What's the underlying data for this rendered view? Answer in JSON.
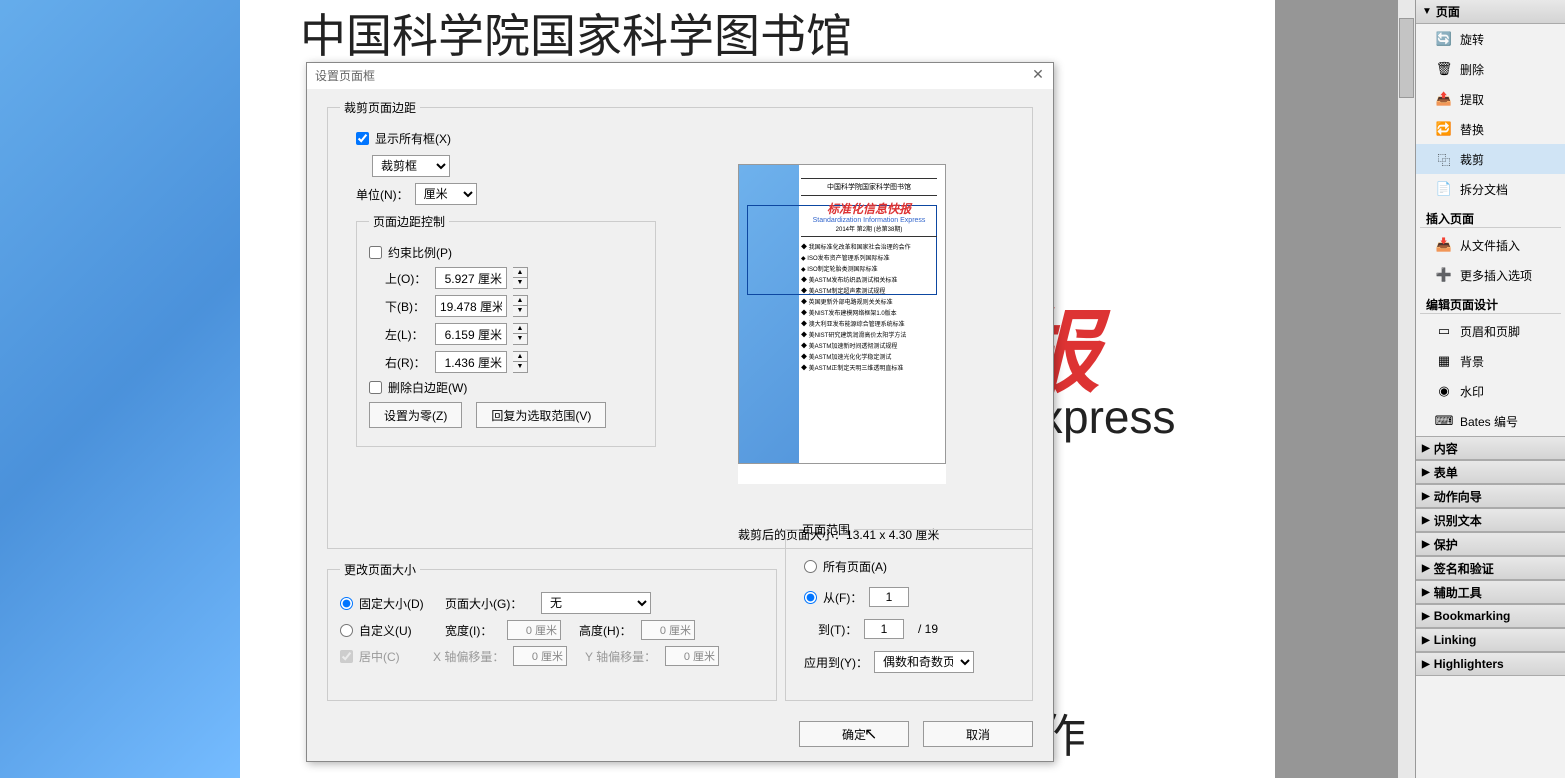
{
  "doc": {
    "title": "中国科学院国家科学图书馆",
    "red": "报",
    "eng": "xpress",
    "foot": "作"
  },
  "dialog": {
    "title": "设置页面框",
    "crop_margin_legend": "裁剪页面边距",
    "show_all_boxes": "显示所有框(X)",
    "box_type": "裁剪框",
    "unit_label": "单位(N)：",
    "unit_value": "厘米",
    "margin_control_legend": "页面边距控制",
    "constrain": "约束比例(P)",
    "top_label": "上(O)：",
    "bottom_label": "下(B)：",
    "left_label": "左(L)：",
    "right_label": "右(R)：",
    "top_val": "5.927 厘米",
    "bottom_val": "19.478 厘米",
    "left_val": "6.159 厘米",
    "right_val": "1.436 厘米",
    "remove_white": "删除白边距(W)",
    "set_zero": "设置为零(Z)",
    "restore_sel": "回复为选取范围(V)",
    "cropped_size_label": "裁剪后的页面大小：",
    "cropped_size_value": "13.41 x 4.30 厘米",
    "change_size_legend": "更改页面大小",
    "fixed_size": "固定大小(D)",
    "page_size_label": "页面大小(G)：",
    "page_size_value": "无",
    "custom": "自定义(U)",
    "width_label": "宽度(I)：",
    "height_label": "高度(H)：",
    "zero_cm": "0 厘米",
    "center": "居中(C)",
    "x_offset": "X 轴偏移量：",
    "y_offset": "Y 轴偏移量：",
    "range_legend": "页面范围",
    "all_pages": "所有页面(A)",
    "from_label": "从(F)：",
    "from_val": "1",
    "to_label": "到(T)：",
    "to_val": "1",
    "total": "/ 19",
    "apply_to_label": "应用到(Y)：",
    "apply_to_value": "偶数和奇数页",
    "ok": "确定",
    "cancel": "取消"
  },
  "preview": {
    "header": "中国科学院国家科学图书馆",
    "red": "标准化信息快报",
    "eng": "Standardization Information Express",
    "sub": "2014年 第2期 (总第38期)"
  },
  "panel": {
    "pages_header": "页面",
    "rotate": "旋转",
    "delete": "删除",
    "extract": "提取",
    "replace": "替换",
    "crop": "裁剪",
    "split": "拆分文档",
    "insert_header": "插入页面",
    "insert_file": "从文件插入",
    "more_insert": "更多插入选项",
    "design_header": "编辑页面设计",
    "header_footer": "页眉和页脚",
    "background": "背景",
    "watermark": "水印",
    "bates": "Bates 编号",
    "content": "内容",
    "forms": "表单",
    "action_wizard": "动作向导",
    "recognize": "识别文本",
    "protect": "保护",
    "signature": "签名和验证",
    "accessibility": "辅助工具",
    "bookmarking": "Bookmarking",
    "linking": "Linking",
    "highlighters": "Highlighters"
  }
}
